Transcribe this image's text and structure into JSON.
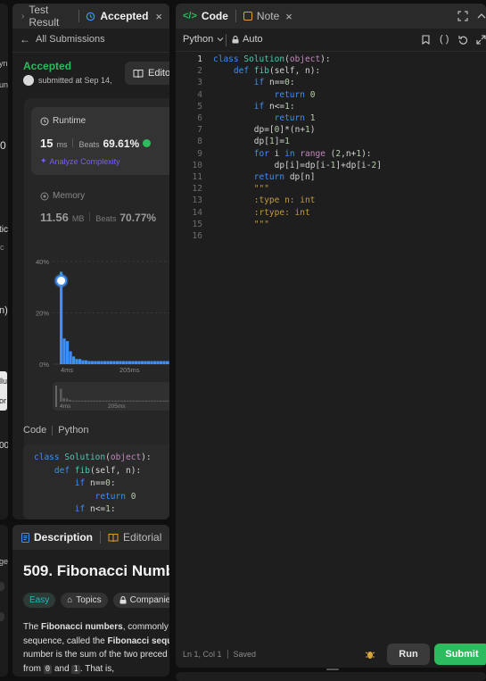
{
  "left_strip": {
    "texts": [
      "yn",
      "un",
      "0",
      "tic",
      "c",
      "n)",
      "llu",
      "or",
      "00",
      "ge"
    ]
  },
  "submission_panel": {
    "tab_test_result": "Test Result",
    "tab_accepted": "Accepted",
    "all_submissions": "All Submissions",
    "status": "Accepted",
    "submitted_at": "submitted at Sep 14,",
    "editorial_button": "Edito",
    "runtime": {
      "title": "Runtime",
      "value": "15",
      "unit": "ms",
      "beats_label": "Beats",
      "beats_value": "69.61%",
      "analyze": "Analyze Complexity"
    },
    "memory": {
      "title": "Memory",
      "value": "11.56",
      "unit": "MB",
      "beats_label": "Beats",
      "beats_value": "70.77%"
    },
    "code_label": "Code",
    "code_lang": "Python",
    "preview_lines": [
      "class Solution(object):",
      "    def fib(self, n):",
      "        if n==0:",
      "            return 0",
      "        if n<=1:"
    ]
  },
  "chart_data": {
    "type": "bar",
    "xlabel": "",
    "ylabel": "",
    "y_ticks": [
      "40%",
      "20%",
      "0%"
    ],
    "x_ticks": [
      "4ms",
      "205ms"
    ],
    "mini_x_ticks": [
      "4ms",
      "205ms"
    ],
    "ylim": [
      0,
      40
    ],
    "highlight_x": "15ms",
    "values": [
      36,
      10,
      9,
      5,
      3,
      2,
      2,
      1.5,
      1.5,
      1.2,
      1.2,
      1.2,
      1.2,
      1.2,
      1.2,
      1.2,
      1.2,
      1.2,
      1.2,
      1.2,
      1.2,
      1.2,
      1.2,
      1.2,
      1.2,
      1.2,
      1.2,
      1.2,
      1.2,
      1.2,
      1.2,
      1.2,
      1.2,
      1.2,
      1.2,
      1.2,
      1.2,
      1.2,
      1.2,
      1.2
    ]
  },
  "description_panel": {
    "tab_description": "Description",
    "tab_editorial": "Editorial",
    "title": "509. Fibonacci Numb",
    "difficulty": "Easy",
    "topics": "Topics",
    "companies": "Companies",
    "p1_pre": "The ",
    "p1_bold1": "Fibonacci numbers",
    "p1_mid": ", commonly d",
    "p2_pre": "sequence, called the ",
    "p2_bold": "Fibonacci sequ",
    "p3": "number is the sum of the two preced",
    "p4_pre": "from ",
    "p4_c0": "0",
    "p4_and": " and ",
    "p4_c1": "1",
    "p4_end": ". That is,"
  },
  "editor": {
    "tab_code": "Code",
    "tab_note": "Note",
    "language": "Python",
    "auto": "Auto",
    "lines": [
      "class Solution(object):",
      "    def fib(self, n):",
      "        if n==0:",
      "            return 0",
      "        if n<=1:",
      "            return 1",
      "        dp=[0]*(n+1)",
      "        dp[1]=1",
      "        for i in range (2,n+1):",
      "            dp[i]=dp[i-1]+dp[i-2]",
      "        return dp[n]",
      "        \"\"\"",
      "        :type n: int",
      "        :rtype: int",
      "        \"\"\"",
      ""
    ],
    "status_pos": "Ln 1, Col 1",
    "status_saved": "Saved",
    "run": "Run",
    "submit": "Submit"
  },
  "colors": {
    "accent_green": "#2cbb5d",
    "accent_blue": "#3e8ef7",
    "keyword_purple": "#c586c0",
    "class_teal": "#4ec9b0"
  }
}
